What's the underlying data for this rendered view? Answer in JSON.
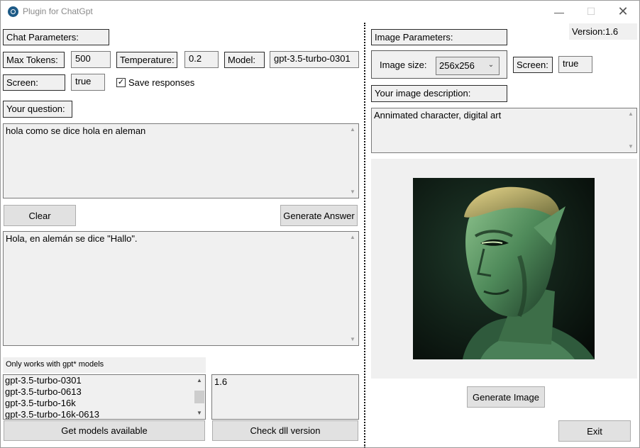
{
  "window": {
    "title": "Plugin for ChatGpt"
  },
  "left": {
    "chat_params_label": "Chat Parameters:",
    "max_tokens_label": "Max Tokens:",
    "max_tokens_value": "500",
    "temperature_label": "Temperature:",
    "temperature_value": "0.2",
    "model_label": "Model:",
    "model_value": "gpt-3.5-turbo-0301",
    "screen_label": "Screen:",
    "screen_value": "true",
    "save_responses_label": "Save responses",
    "save_responses_checked": true,
    "question_label": "Your question:",
    "question_text": "hola como se dice hola en aleman",
    "clear_label": "Clear",
    "generate_answer_label": "Generate Answer",
    "answer_text": "Hola, en alemán se dice \"Hallo\".",
    "models_note": "Only works with gpt* models",
    "models": [
      "gpt-3.5-turbo-0301",
      "gpt-3.5-turbo-0613",
      "gpt-3.5-turbo-16k",
      "gpt-3.5-turbo-16k-0613"
    ],
    "dll_version_output": "1.6",
    "get_models_label": "Get  models available",
    "check_dll_label": "Check dll version"
  },
  "right": {
    "version_label": "Version:1.6",
    "image_params_label": "Image Parameters:",
    "image_size_label": "Image size:",
    "image_size_value": "256x256",
    "screen_label": "Screen:",
    "screen_value": "true",
    "image_desc_label": "Your image description:",
    "image_desc_text": "Annimated character, digital art",
    "generate_image_label": "Generate Image",
    "exit_label": "Exit"
  },
  "icons": {
    "app": "app-icon",
    "minimize": "minimize-icon",
    "maximize": "maximize-icon",
    "close": "close-icon",
    "checkmark": "check-icon",
    "chevron": "chevron-down-icon",
    "scroll_up": "scroll-up-icon",
    "scroll_down": "scroll-down-icon"
  },
  "colors": {
    "panel": "#f0f0f0",
    "button": "#e1e1e1",
    "accent": "#1d5a86"
  }
}
